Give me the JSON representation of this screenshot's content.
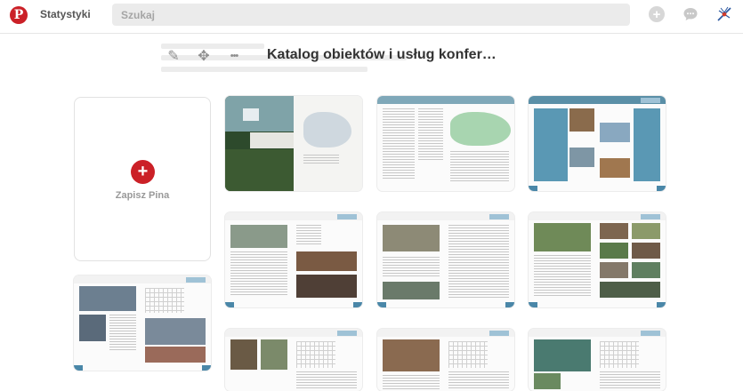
{
  "header": {
    "logo_letter": "P",
    "stats_label": "Statystyki",
    "search_placeholder": "Szukaj",
    "plus_glyph": "+"
  },
  "board": {
    "title": "Katalog obiektów i usług konfer…",
    "tools": [
      {
        "name": "edit-pencil-icon",
        "glyph": "✎"
      },
      {
        "name": "move-icon",
        "glyph": "✥"
      },
      {
        "name": "more-icon",
        "glyph": "•••"
      }
    ]
  },
  "save_pin": {
    "glyph": "+",
    "label": "Zapisz Pina"
  },
  "colors": {
    "brand_red": "#cb2027",
    "catalog_blue": "#4a87a8"
  }
}
